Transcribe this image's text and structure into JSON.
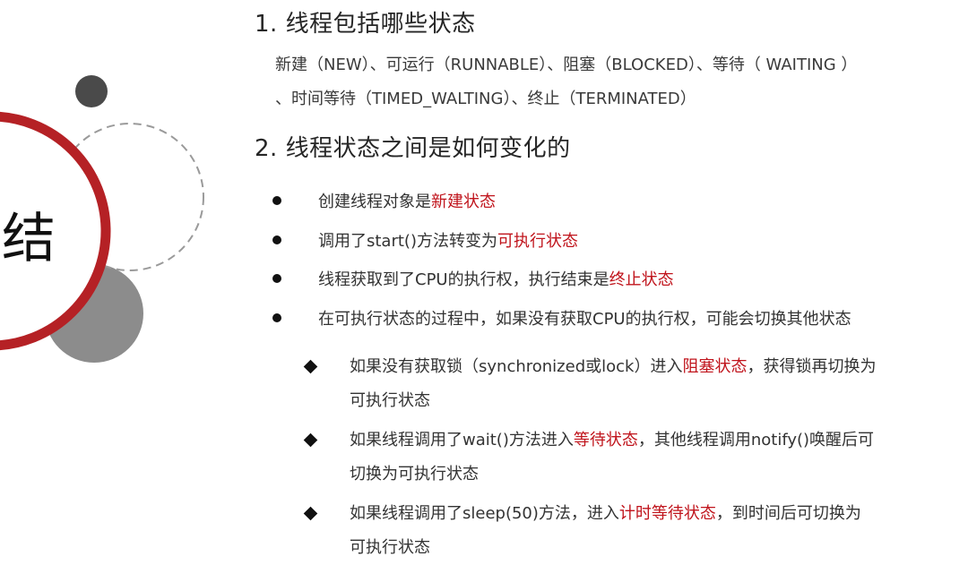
{
  "side": {
    "title_fragment": "结"
  },
  "section1": {
    "title": "1.  线程包括哪些状态",
    "states_line1": "新建（NEW）、可运行（RUNNABLE）、阻塞（BLOCKED）、等待（ WAITING ）",
    "states_line2": "、时间等待（TIMED_WALTING）、终止（TERMINATED）"
  },
  "section2": {
    "title": "2.  线程状态之间是如何变化的",
    "bullets": [
      {
        "pre": "创建线程对象是",
        "em": "新建状态",
        "post": ""
      },
      {
        "pre": "调用了start()方法转变为",
        "em": "可执行状态",
        "post": ""
      },
      {
        "pre": "线程获取到了CPU的执行权，执行结束是",
        "em": "终止状态",
        "post": ""
      },
      {
        "pre": "在可执行状态的过程中，如果没有获取CPU的执行权，可能会切换其他状态",
        "em": "",
        "post": ""
      }
    ],
    "subs": [
      {
        "pre": "如果没有获取锁（synchronized或lock）进入",
        "em": "阻塞状态",
        "post": "，获得锁再切换为",
        "line2": "可执行状态"
      },
      {
        "pre": "如果线程调用了wait()方法进入",
        "em": "等待状态",
        "post": "，其他线程调用notify()唤醒后可",
        "line2": "切换为可执行状态"
      },
      {
        "pre": "如果线程调用了sleep(50)方法，进入",
        "em": "计时等待状态",
        "post": "，到时间后可切换为",
        "line2": "可执行状态"
      }
    ]
  }
}
